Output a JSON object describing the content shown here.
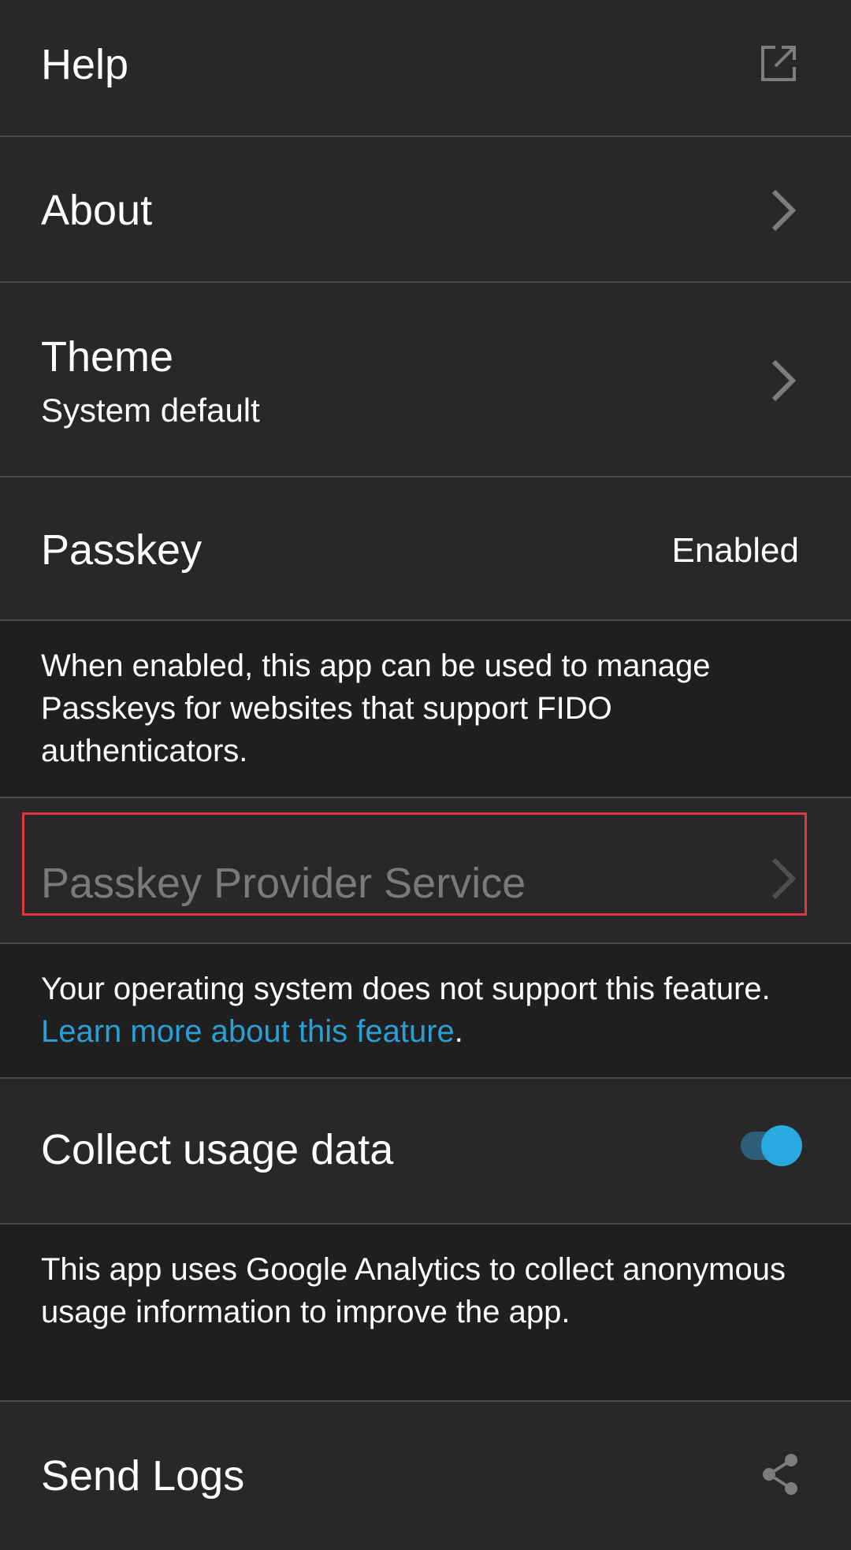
{
  "settings": {
    "help": {
      "label": "Help",
      "icon": "open-external-icon"
    },
    "about": {
      "label": "About",
      "icon": "chevron-right-icon"
    },
    "theme": {
      "label": "Theme",
      "value": "System default",
      "icon": "chevron-right-icon"
    },
    "passkey": {
      "label": "Passkey",
      "value": "Enabled",
      "description": "When enabled, this app can be used to manage Passkeys for websites that support FIDO authenticators."
    },
    "passkey_provider": {
      "label": "Passkey Provider Service",
      "state": "disabled",
      "icon": "chevron-right-icon",
      "description_text": "Your operating system does not support this feature. ",
      "description_link": "Learn more about this feature",
      "description_end": "."
    },
    "usage_data": {
      "label": "Collect usage data",
      "toggle_on": true,
      "description": "This app uses Google Analytics to collect anonymous usage information to improve the app."
    },
    "send_logs": {
      "label": "Send Logs",
      "icon": "share-icon"
    }
  },
  "colors": {
    "background": "#282828",
    "description_background": "#1f1f1f",
    "divider": "#4a4a4a",
    "accent": "#2aa8e0",
    "link": "#2a9fd6",
    "highlight_border": "#e0373d"
  }
}
